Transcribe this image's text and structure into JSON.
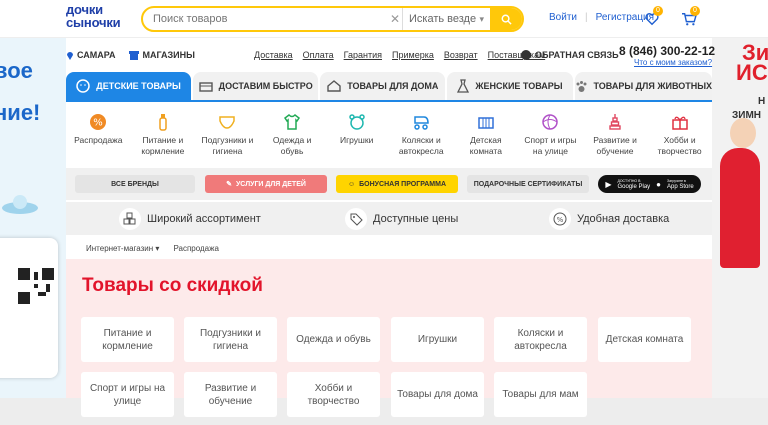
{
  "logo": {
    "line1": "дочки",
    "line2": "сыночки"
  },
  "search": {
    "placeholder": "Поиск товаров",
    "scope": "Искать везде"
  },
  "auth": {
    "login": "Войти",
    "register": "Регистрация"
  },
  "badges": {
    "favorites": "0",
    "cart": "0"
  },
  "city": "САМАРА",
  "stores": "МАГАЗИНЫ",
  "info_links": [
    "Доставка",
    "Оплата",
    "Гарантия",
    "Примерка",
    "Возврат",
    "Поставщикам"
  ],
  "feedback": "ОБРАТНАЯ СВЯЗЬ",
  "phone": "8 (846) 300-22-12",
  "callback": "Что с моим заказом?",
  "tabs": [
    "ДЕТСКИЕ ТОВАРЫ",
    "ДОСТАВИМ БЫСТРО",
    "ТОВАРЫ ДЛЯ ДОМА",
    "ЖЕНСКИЕ ТОВАРЫ",
    "ТОВАРЫ ДЛЯ ЖИВОТНЫХ"
  ],
  "categories": [
    {
      "l1": "Распродажа",
      "l2": "",
      "color": "#f08a24"
    },
    {
      "l1": "Питание и",
      "l2": "кормление",
      "color": "#f0a020"
    },
    {
      "l1": "Подгузники и",
      "l2": "гигиена",
      "color": "#f0b020"
    },
    {
      "l1": "Одежда и",
      "l2": "обувь",
      "color": "#22aa55"
    },
    {
      "l1": "Игрушки",
      "l2": "",
      "color": "#20b8b0"
    },
    {
      "l1": "Коляски и",
      "l2": "автокресла",
      "color": "#2088dd"
    },
    {
      "l1": "Детская",
      "l2": "комната",
      "color": "#3070d8"
    },
    {
      "l1": "Спорт и игры",
      "l2": "на улице",
      "color": "#b050c8"
    },
    {
      "l1": "Развитие и",
      "l2": "обучение",
      "color": "#e04860"
    },
    {
      "l1": "Хобби и",
      "l2": "творчество",
      "color": "#e03040"
    }
  ],
  "promo": {
    "brands": "ВСЕ БРЕНДЫ",
    "services": "УСЛУГИ ДЛЯ ДЕТЕЙ",
    "bonus": "БОНУСНАЯ ПРОГРАММА",
    "certs": "ПОДАРОЧНЫЕ СЕРТИФИКАТЫ",
    "apps": {
      "gp_small": "ДОСТУПНО В",
      "gp": "Google Play",
      "as_small": "Загрузите в",
      "as": "App Store"
    }
  },
  "features": [
    "Широкий ассортимент",
    "Доступные цены",
    "Удобная доставка"
  ],
  "breadcrumbs": [
    "Интернет-магазин",
    "Распродажа"
  ],
  "sale_title": "Товары со скидкой",
  "sale_cards": [
    {
      "l1": "Питание и",
      "l2": "кормление"
    },
    {
      "l1": "Подгузники и",
      "l2": "гигиена"
    },
    {
      "l1": "Одежда и обувь",
      "l2": ""
    },
    {
      "l1": "Игрушки",
      "l2": ""
    },
    {
      "l1": "Коляски и",
      "l2": "автокресла"
    },
    {
      "l1": "Детская комната",
      "l2": ""
    },
    {
      "l1": "Спорт и игры на",
      "l2": "улице"
    },
    {
      "l1": "Развитие и",
      "l2": "обучение"
    },
    {
      "l1": "Хобби и",
      "l2": "творчество"
    },
    {
      "l1": "Товары для дома",
      "l2": ""
    },
    {
      "l1": "Товары для мам",
      "l2": ""
    }
  ],
  "left_banner": {
    "t1": "вое",
    "t2": "ние!"
  },
  "right_banner": {
    "t1": "Зи",
    "t2": "ИС",
    "t3": "Н",
    "t4": "ЗИМН"
  },
  "colors": {
    "brand_blue": "#1e86e5",
    "yellow": "#ffc80a",
    "sale_red": "#e2142b",
    "services_bg": "#f07a7a"
  }
}
